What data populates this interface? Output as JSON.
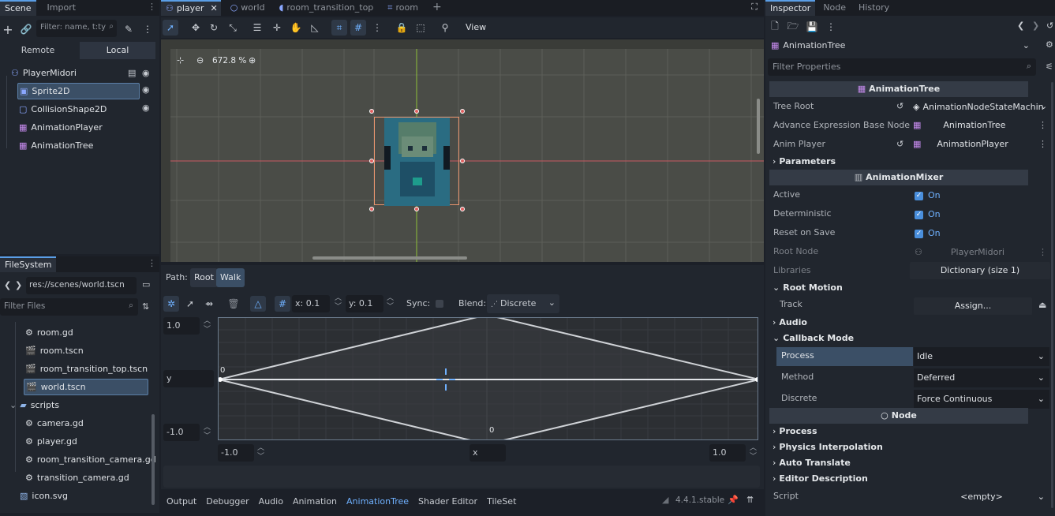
{
  "left_dock": {
    "tabs": [
      "Scene",
      "Import"
    ],
    "filter_placeholder": "Filter: name, t:ty",
    "mode_tabs": [
      "Remote",
      "Local"
    ],
    "nodes": [
      {
        "label": "PlayerMidori",
        "icon": "character-body-icon"
      },
      {
        "label": "Sprite2D",
        "icon": "sprite-icon"
      },
      {
        "label": "CollisionShape2D",
        "icon": "collision-shape-icon"
      },
      {
        "label": "AnimationPlayer",
        "icon": "animation-player-icon"
      },
      {
        "label": "AnimationTree",
        "icon": "animation-tree-icon"
      }
    ]
  },
  "filesystem": {
    "tab": "FileSystem",
    "path": "res://scenes/world.tscn",
    "filter_placeholder": "Filter Files",
    "items": [
      {
        "label": "room.gd",
        "icon": "gear-icon"
      },
      {
        "label": "room.tscn",
        "icon": "clapper-icon"
      },
      {
        "label": "room_transition_top.tscn",
        "icon": "clapper-icon"
      },
      {
        "label": "world.tscn",
        "icon": "clapper-icon"
      },
      {
        "label": "scripts",
        "icon": "folder-icon"
      },
      {
        "label": "camera.gd",
        "icon": "gear-icon"
      },
      {
        "label": "player.gd",
        "icon": "gear-icon"
      },
      {
        "label": "room_transition_camera.gd",
        "icon": "gear-icon"
      },
      {
        "label": "transition_camera.gd",
        "icon": "gear-icon"
      },
      {
        "label": "icon.svg",
        "icon": "image-icon"
      }
    ]
  },
  "editor_tabs": [
    {
      "label": "player",
      "active": true
    },
    {
      "label": "world",
      "active": false
    },
    {
      "label": "room_transition_top",
      "active": false
    },
    {
      "label": "room",
      "active": false
    }
  ],
  "toolbar": {
    "view_label": "View"
  },
  "viewport": {
    "zoom": "672.8 %"
  },
  "blend_editor": {
    "path_label": "Path:",
    "path_root": "Root",
    "path_walk": "Walk",
    "x_snap": "x: 0.1",
    "y_snap": "y: 0.1",
    "sync_label": "Sync:",
    "blend_label": "Blend:",
    "blend_value": "Discrete",
    "y_max": "1.0",
    "y_label": "y",
    "y_min": "-1.0",
    "x_min": "-1.0",
    "x_label": "x",
    "x_max": "1.0",
    "point_left_label": "0",
    "point_bottom_label": "0"
  },
  "bottom_tabs": [
    "Output",
    "Debugger",
    "Audio",
    "Animation",
    "AnimationTree",
    "Shader Editor",
    "TileSet"
  ],
  "version": "4.4.1.stable",
  "inspector": {
    "tabs": [
      "Inspector",
      "Node",
      "History"
    ],
    "object_name": "AnimationTree",
    "filter_placeholder": "Filter Properties",
    "class_header": "AnimationTree",
    "tree_root_label": "Tree Root",
    "tree_root_value": "AnimationNodeStateMachin",
    "advance_label": "Advance Expression Base Node",
    "advance_value": "AnimationTree",
    "anim_player_label": "Anim Player",
    "anim_player_value": "AnimationPlayer",
    "parameters": "Parameters",
    "mixer_header": "AnimationMixer",
    "active_label": "Active",
    "deterministic_label": "Deterministic",
    "reset_label": "Reset on Save",
    "on_text": "On",
    "root_node_label": "Root Node",
    "root_node_value": "PlayerMidori",
    "libraries_label": "Libraries",
    "libraries_value": "Dictionary (size 1)",
    "root_motion": "Root Motion",
    "track_label": "Track",
    "track_value": "Assign...",
    "audio": "Audio",
    "callback_mode": "Callback Mode",
    "process_label": "Process",
    "process_value": "Idle",
    "method_label": "Method",
    "method_value": "Deferred",
    "discrete_label": "Discrete",
    "discrete_value": "Force Continuous",
    "node_header": "Node",
    "process_section": "Process",
    "physics_interp": "Physics Interpolation",
    "auto_translate": "Auto Translate",
    "editor_description": "Editor Description",
    "script_label": "Script",
    "script_value": "<empty>"
  },
  "colors": {
    "accent": "#5a9ee6",
    "selection": "#3b4f66",
    "background": "#21262e",
    "viewport": "#4a4c47",
    "blend_bg": "#2c2f33"
  }
}
